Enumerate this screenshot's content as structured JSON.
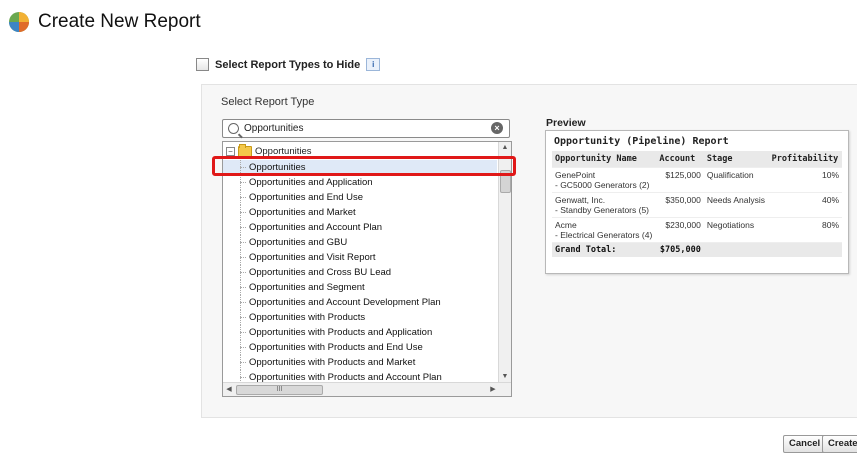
{
  "header": {
    "title": "Create New Report",
    "logo_icon": "salesforce-cloud-icon"
  },
  "hide_types": {
    "label": "Select Report Types to Hide",
    "checked": false,
    "info_icon": "info-icon"
  },
  "select_type": {
    "label": "Select Report Type",
    "search": {
      "value": "Opportunities"
    },
    "tree": {
      "root": "Opportunities",
      "items": [
        "Opportunities",
        "Opportunities and Application",
        "Opportunities and End Use",
        "Opportunities and Market",
        "Opportunities and Account Plan",
        "Opportunities and GBU",
        "Opportunities and Visit Report",
        "Opportunities and Cross BU Lead",
        "Opportunities and Segment",
        "Opportunities and Account Development Plan",
        "Opportunities with Products",
        "Opportunities with Products and Application",
        "Opportunities with Products and End Use",
        "Opportunities with Products and Market",
        "Opportunities with Products and Account Plan"
      ],
      "selected": "Opportunities",
      "hscroll_label": "III"
    }
  },
  "preview": {
    "label": "Preview",
    "report_title": "Opportunity (Pipeline) Report",
    "columns": [
      "Opportunity Name",
      "Account",
      "Stage",
      "Profitability"
    ],
    "rows": [
      {
        "name": "GenePoint",
        "sub": "- GC5000 Generators (2)",
        "account": "$125,000",
        "stage": "Qualification",
        "profit": "10%"
      },
      {
        "name": "Genwatt, Inc.",
        "sub": "- Standby Generators (5)",
        "account": "$350,000",
        "stage": "Needs Analysis",
        "profit": "40%"
      },
      {
        "name": "Acme",
        "sub": "- Electrical Generators (4)",
        "account": "$230,000",
        "stage": "Negotiations",
        "profit": "80%"
      }
    ],
    "total": {
      "label": "Grand Total:",
      "value": "$705,000"
    }
  },
  "buttons": {
    "cancel": "Cancel",
    "create": "Create"
  }
}
